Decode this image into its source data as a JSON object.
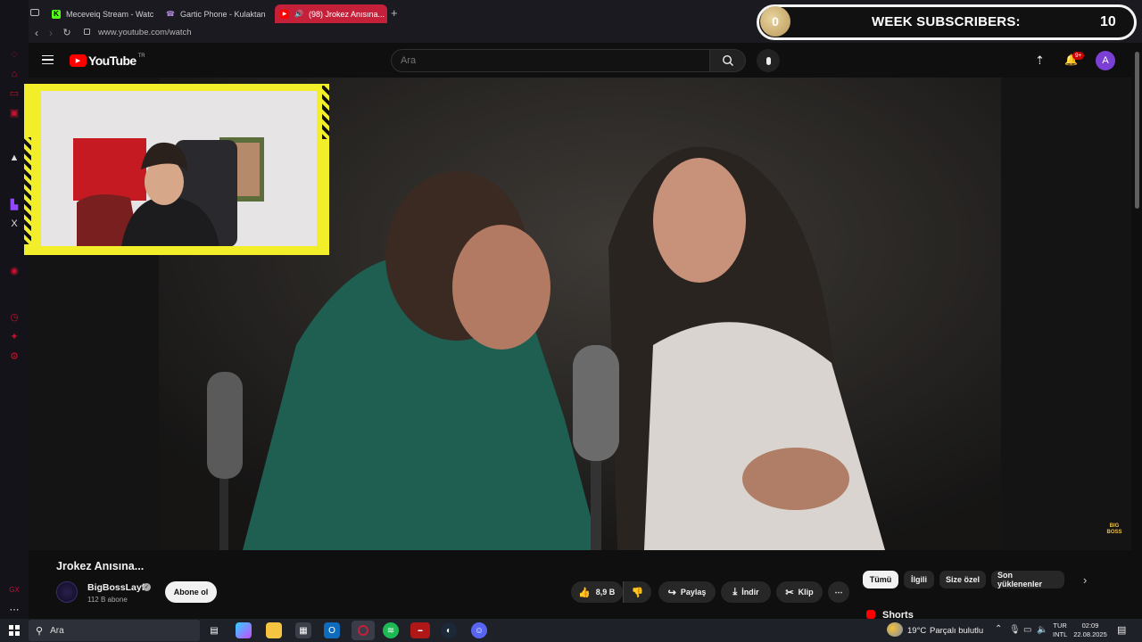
{
  "browser": {
    "tabs": [
      {
        "label": "Meceveiq Stream - Watch",
        "icon": "kick-icon",
        "color": "#53fc18"
      },
      {
        "label": "Gartic Phone - Kulaktan K",
        "icon": "phone-icon",
        "color": "#b38be0"
      },
      {
        "label": "(98) Jrokez Anısına...",
        "icon": "youtube-icon",
        "color": "#ff0000"
      }
    ],
    "new_tab": "+",
    "url": "www.youtube.com/watch"
  },
  "overlay": {
    "coin_value": "0",
    "title": "WEEK SUBSCRIBERS:",
    "count": "10"
  },
  "youtube": {
    "logo": "YouTube",
    "region": "TR",
    "search_placeholder": "Ara",
    "notification_badge": "9+",
    "avatar_letter": "A"
  },
  "video": {
    "title": "Jrokez Anısına...",
    "watermark": "BIG BOSS"
  },
  "channel": {
    "name": "BigBossLayf",
    "subscribers": "112 B abone",
    "subscribe_label": "Abone ol"
  },
  "actions": {
    "likes": "8,9 B",
    "share": "Paylaş",
    "download": "İndir",
    "clip": "Klip",
    "more": "⋯"
  },
  "filters": [
    "Tümü",
    "İlgili",
    "Size özel",
    "Son yüklenenler"
  ],
  "shorts_label": "Shorts",
  "taskbar": {
    "search_placeholder": "Ara",
    "weather_temp": "19°C",
    "weather_desc": "Parçalı bulutlu",
    "lang_top": "TUR",
    "lang_bottom": "INTL",
    "time": "02:09",
    "date": "22.08.2025"
  },
  "colors": {
    "accent": "#c4203a",
    "overlay_yellow": "#f2ee2a",
    "sub_button": "#f1f1f1"
  }
}
